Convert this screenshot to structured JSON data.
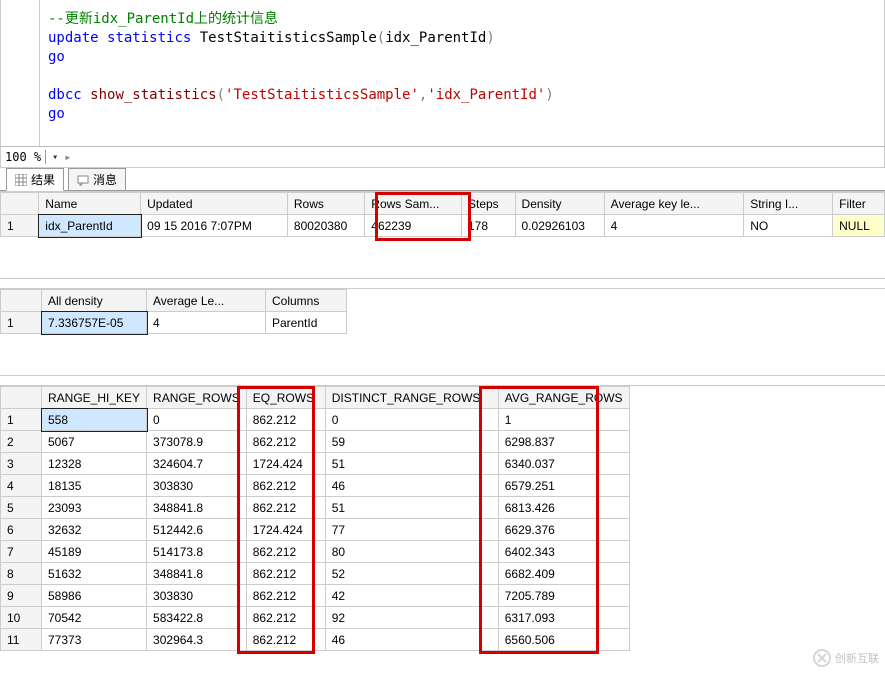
{
  "editor": {
    "comment": "--更新idx_ParentId上的统计信息",
    "line2a": "update",
    "line2b": "statistics",
    "line2c": "TestStaitisticsSample",
    "line2d": "idx_ParentId",
    "line3": "go",
    "line5a": "dbcc",
    "line5b": "show_statistics",
    "line5s1": "'TestStaitisticsSample'",
    "line5s2": "'idx_ParentId'",
    "line6": "go"
  },
  "zoom": {
    "label": "100 %",
    "glyph": "▾"
  },
  "tabs": {
    "results": "结果",
    "messages": "消息"
  },
  "stats1": {
    "headers": [
      "Name",
      "Updated",
      "Rows",
      "Rows Sam...",
      "Steps",
      "Density",
      "Average key le...",
      "String I...",
      "Filter"
    ],
    "rownum": "1",
    "row": [
      "idx_ParentId",
      "09 15 2016  7:07PM",
      "80020380",
      "462239",
      "178",
      "0.02926103",
      "4",
      "NO",
      "NULL"
    ]
  },
  "stats2": {
    "headers": [
      "All density",
      "Average Le...",
      "Columns"
    ],
    "rownum": "1",
    "row": [
      "7.336757E-05",
      "4",
      "ParentId"
    ]
  },
  "hist": {
    "headers": [
      "RANGE_HI_KEY",
      "RANGE_ROWS",
      "EQ_ROWS",
      "DISTINCT_RANGE_ROWS",
      "AVG_RANGE_ROWS"
    ],
    "rows": [
      [
        "1",
        "558",
        "0",
        "862.212",
        "0",
        "1"
      ],
      [
        "2",
        "5067",
        "373078.9",
        "862.212",
        "59",
        "6298.837"
      ],
      [
        "3",
        "12328",
        "324604.7",
        "1724.424",
        "51",
        "6340.037"
      ],
      [
        "4",
        "18135",
        "303830",
        "862.212",
        "46",
        "6579.251"
      ],
      [
        "5",
        "23093",
        "348841.8",
        "862.212",
        "51",
        "6813.426"
      ],
      [
        "6",
        "32632",
        "512442.6",
        "1724.424",
        "77",
        "6629.376"
      ],
      [
        "7",
        "45189",
        "514173.8",
        "862.212",
        "80",
        "6402.343"
      ],
      [
        "8",
        "51632",
        "348841.8",
        "862.212",
        "52",
        "6682.409"
      ],
      [
        "9",
        "58986",
        "303830",
        "862.212",
        "42",
        "7205.789"
      ],
      [
        "10",
        "70542",
        "583422.8",
        "862.212",
        "92",
        "6317.093"
      ],
      [
        "11",
        "77373",
        "302964.3",
        "862.212",
        "46",
        "6560.506"
      ]
    ]
  },
  "watermark": "创新互联"
}
